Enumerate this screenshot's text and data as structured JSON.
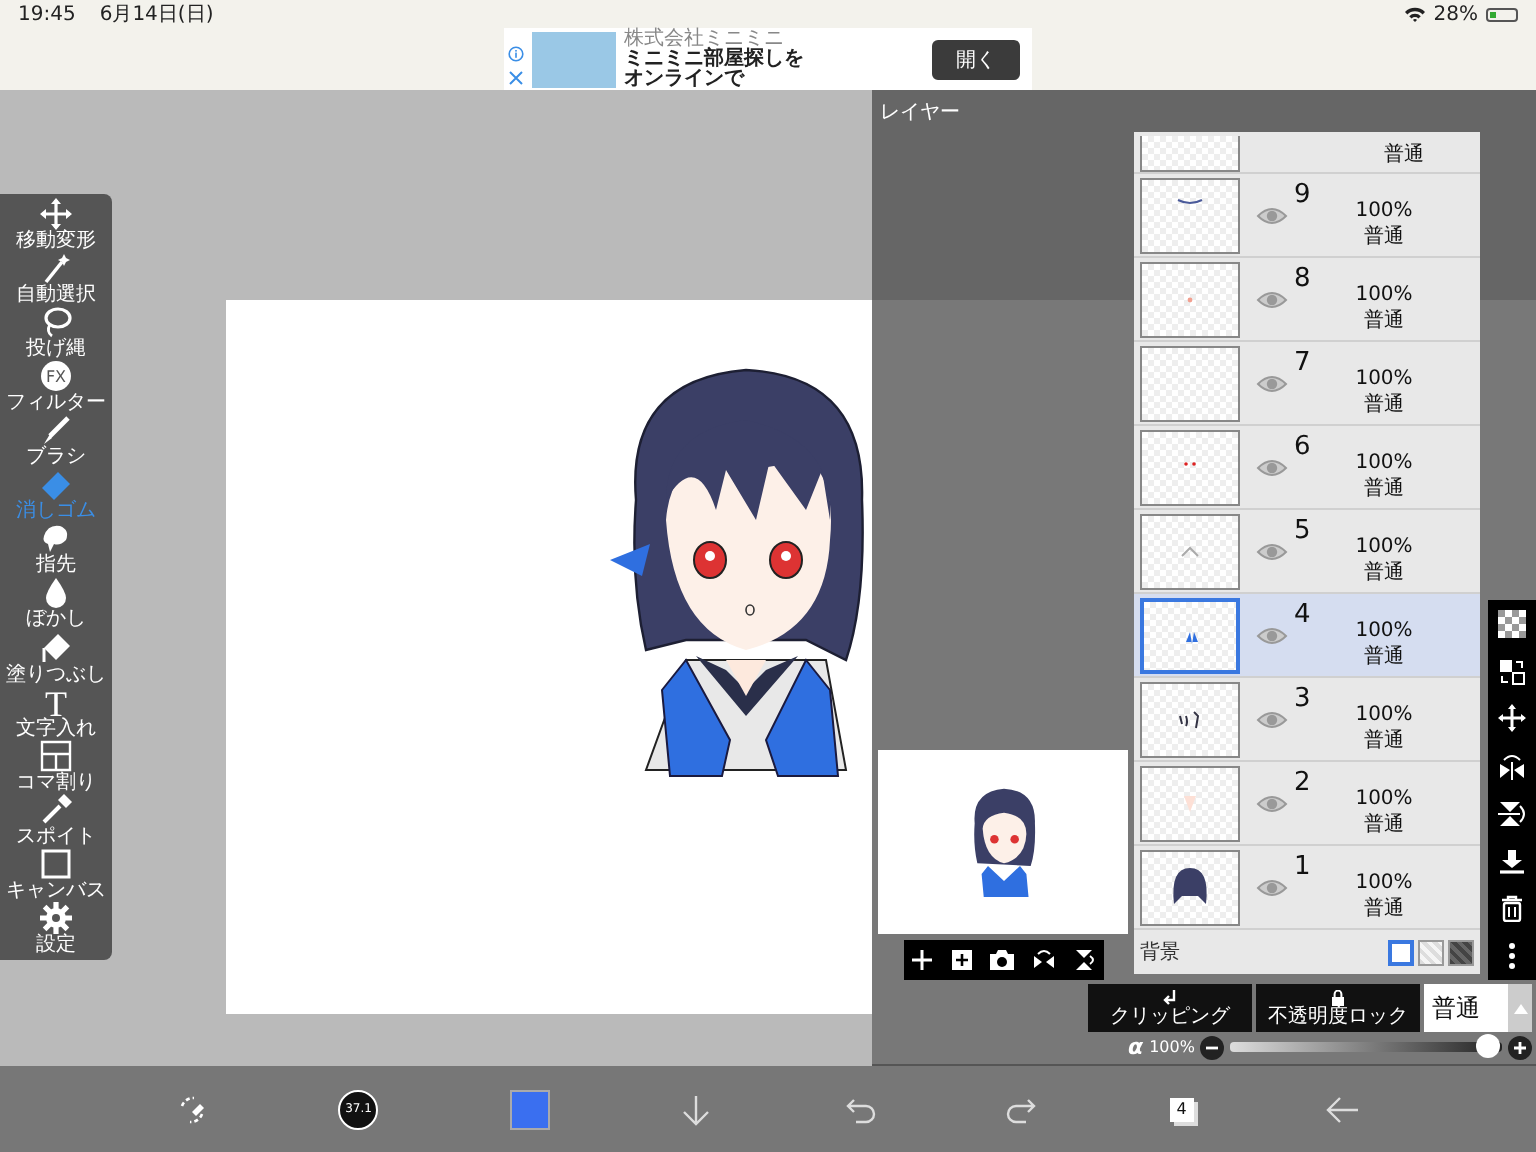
{
  "status_bar": {
    "time": "19:45",
    "date": "6月14日(日)",
    "battery": "28%"
  },
  "ad": {
    "company": "株式会社ミニミニ",
    "headline": [
      "ミニミニ部屋探しを",
      "オンラインで"
    ],
    "button": "開く"
  },
  "tools": [
    {
      "kind": "move",
      "label": "移動変形",
      "selected": false
    },
    {
      "kind": "wand",
      "label": "自動選択",
      "selected": false
    },
    {
      "kind": "lasso",
      "label": "投げ縄",
      "selected": false
    },
    {
      "kind": "fx",
      "label": "フィルター",
      "icon_text": "FX",
      "selected": false
    },
    {
      "kind": "brush",
      "label": "ブラシ",
      "selected": false
    },
    {
      "kind": "eraser",
      "label": "消しゴム",
      "selected": true
    },
    {
      "kind": "finger",
      "label": "指先",
      "selected": false
    },
    {
      "kind": "blur",
      "label": "ぼかし",
      "selected": false
    },
    {
      "kind": "fill",
      "label": "塗りつぶし",
      "selected": false
    },
    {
      "kind": "text",
      "label": "文字入れ",
      "icon_text": "T",
      "selected": false
    },
    {
      "kind": "frame",
      "label": "コマ割り",
      "selected": false
    },
    {
      "kind": "eyedropper",
      "label": "スポイト",
      "selected": false
    },
    {
      "kind": "canvas",
      "label": "キャンバス",
      "selected": false
    },
    {
      "kind": "settings",
      "label": "設定",
      "selected": false
    }
  ],
  "layer_panel": {
    "title": "レイヤー",
    "partial_layer": {
      "blend": "普通"
    },
    "layers": [
      {
        "number": "9",
        "opacity": "100%",
        "blend": "普通",
        "selected": false
      },
      {
        "number": "8",
        "opacity": "100%",
        "blend": "普通",
        "selected": false
      },
      {
        "number": "7",
        "opacity": "100%",
        "blend": "普通",
        "selected": false
      },
      {
        "number": "6",
        "opacity": "100%",
        "blend": "普通",
        "selected": false
      },
      {
        "number": "5",
        "opacity": "100%",
        "blend": "普通",
        "selected": false
      },
      {
        "number": "4",
        "opacity": "100%",
        "blend": "普通",
        "selected": true
      },
      {
        "number": "3",
        "opacity": "100%",
        "blend": "普通",
        "selected": false
      },
      {
        "number": "2",
        "opacity": "100%",
        "blend": "普通",
        "selected": false
      },
      {
        "number": "1",
        "opacity": "100%",
        "blend": "普通",
        "selected": false
      }
    ],
    "background": {
      "label": "背景",
      "swatches": [
        {
          "kind": "white",
          "selected": true
        },
        {
          "kind": "transparent",
          "selected": false
        },
        {
          "kind": "dark",
          "selected": false
        }
      ]
    },
    "clipping": "クリッピング",
    "alpha_lock": "不透明度ロック",
    "blend_mode": "普通",
    "alpha": {
      "symbol": "α",
      "reading": "100%",
      "level": 0.95
    }
  },
  "bottom_bar": {
    "brush_size": "37.1",
    "layer_count": "4"
  }
}
